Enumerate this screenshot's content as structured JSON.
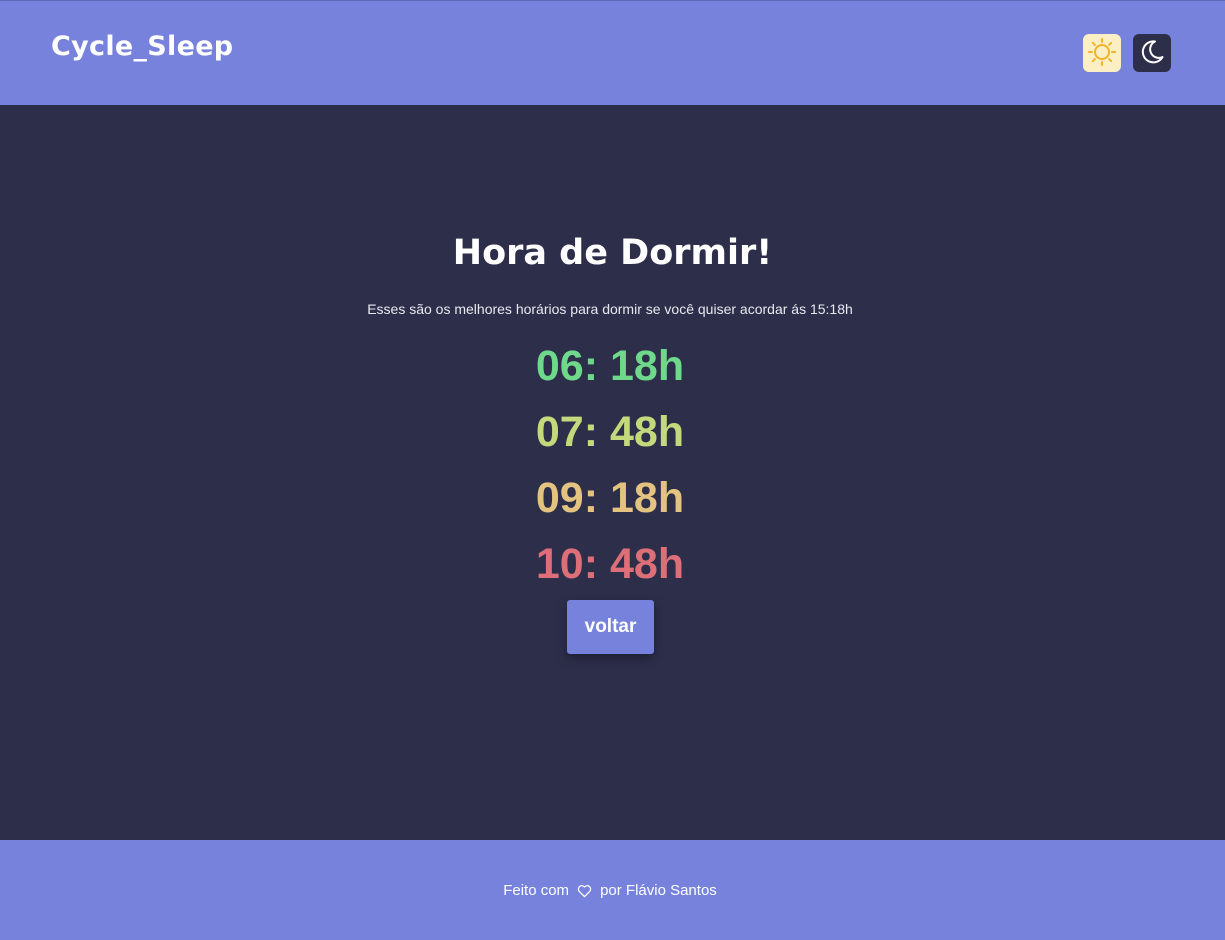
{
  "app": {
    "brand": "Cycle_Sleep"
  },
  "theme_toggle": {
    "light_icon": "sun-icon",
    "dark_icon": "moon-icon"
  },
  "main": {
    "title": "Hora de Dormir!",
    "subtitle": "Esses são os melhores horários para dormir se você quiser acordar ás 15:18h",
    "times": [
      {
        "label": "06: 18h",
        "color": "#6ed98b"
      },
      {
        "label": "07: 48h",
        "color": "#c3d97c"
      },
      {
        "label": "09: 18h",
        "color": "#e3c37f"
      },
      {
        "label": "10: 48h",
        "color": "#dc6f78"
      }
    ],
    "back_label": "voltar"
  },
  "footer": {
    "made_with": "Feito com",
    "heart_icon": "heart-icon",
    "by": "por Flávio Santos"
  },
  "colors": {
    "accent": "#7782dc",
    "background": "#2d2e4a",
    "light_button": "#fcefc4",
    "sun": "#f0b429"
  }
}
